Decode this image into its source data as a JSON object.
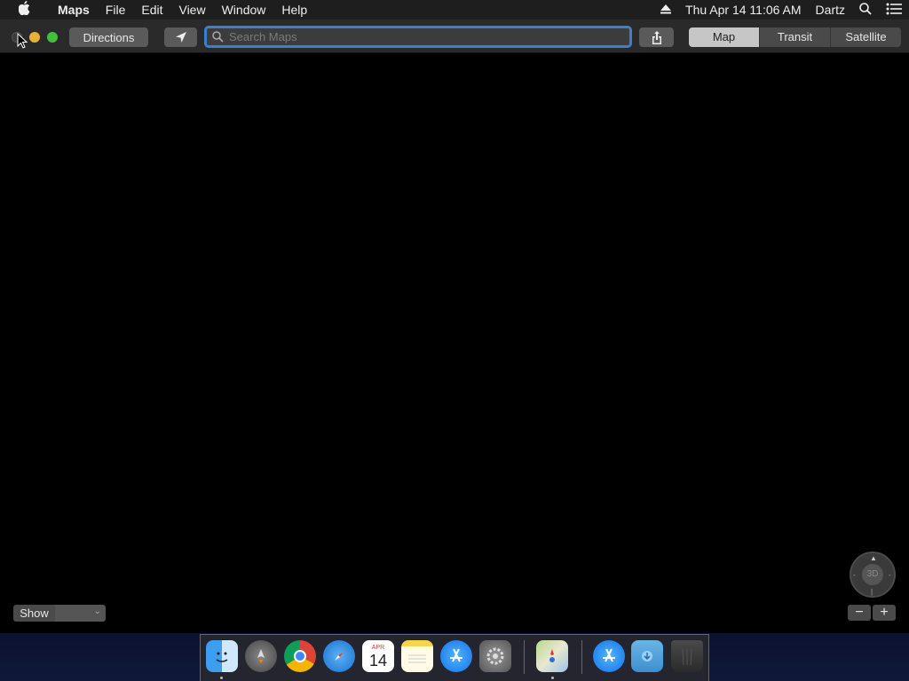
{
  "menubar": {
    "apple_icon": "apple-logo-icon",
    "app_name": "Maps",
    "menus": [
      "File",
      "Edit",
      "View",
      "Window",
      "Help"
    ],
    "datetime": "Thu Apr 14  11:06 AM",
    "user": "Dartz"
  },
  "toolbar": {
    "directions_label": "Directions",
    "search_placeholder": "Search Maps",
    "map_types": [
      "Map",
      "Transit",
      "Satellite"
    ],
    "selected_map_type": "Map"
  },
  "map_controls": {
    "compass_label": "3D",
    "zoom_out": "−",
    "zoom_in": "+",
    "show_label": "Show"
  },
  "dock": {
    "items": [
      "finder-icon",
      "launchpad-icon",
      "chrome-icon",
      "safari-icon",
      "calendar-icon",
      "notes-icon",
      "app-store-icon",
      "system-preferences-icon",
      "maps-icon",
      "app-store-icon",
      "downloads-folder-icon",
      "trash-icon"
    ],
    "calendar_day": "14",
    "calendar_month": "APR"
  }
}
